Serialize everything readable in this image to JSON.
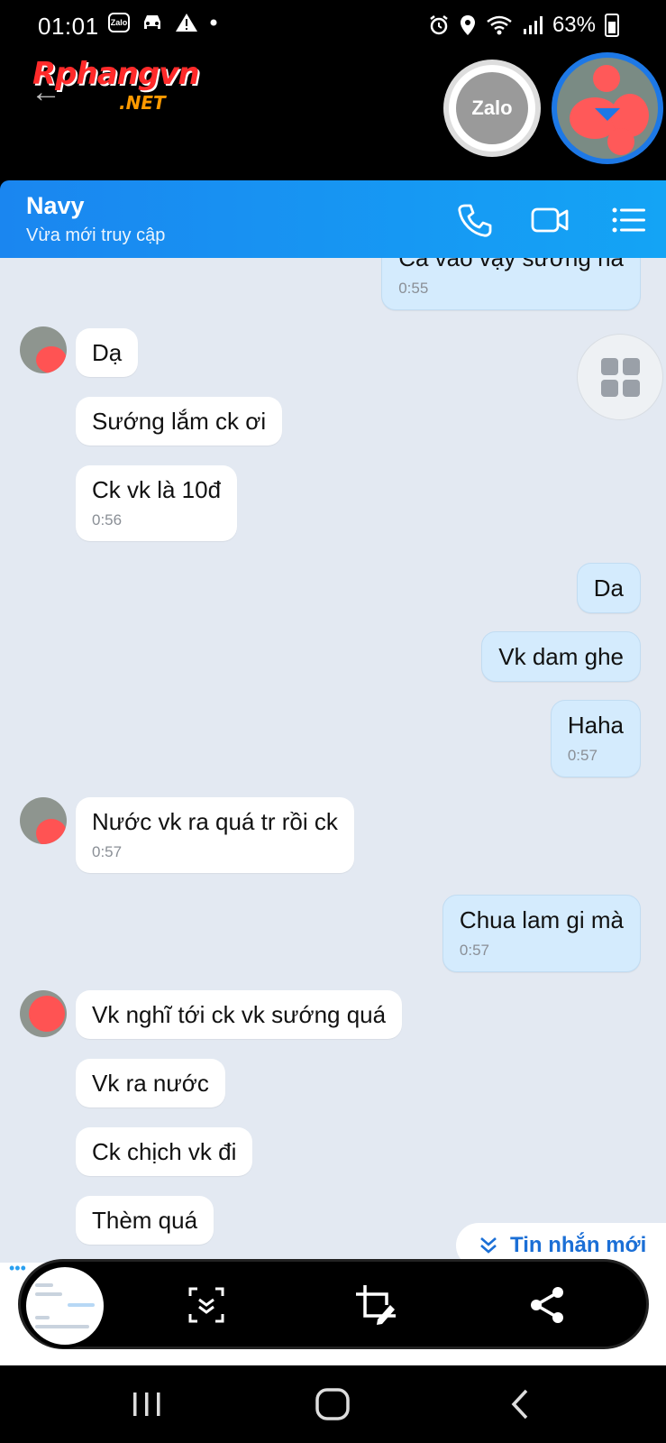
{
  "status_bar": {
    "time": "01:01",
    "zalo_icon_text": "Zalo",
    "battery": "63%"
  },
  "watermark": {
    "main": "Rphangvn",
    "sub": ".NET"
  },
  "zalo_bubble_label": "Zalo",
  "header": {
    "name": "Navy",
    "presence": "Vừa mới truy cập"
  },
  "messages": [
    {
      "id": "m0",
      "dir": "out",
      "text": "Ca vào vậy sướng ha",
      "time": "0:55"
    },
    {
      "id": "m1",
      "dir": "in",
      "text": "Dạ",
      "time": ""
    },
    {
      "id": "m2",
      "dir": "in",
      "text": "Sướng lắm ck ơi",
      "time": ""
    },
    {
      "id": "m3",
      "dir": "in",
      "text": "Ck vk là 10đ",
      "time": "0:56"
    },
    {
      "id": "m4",
      "dir": "out",
      "text": "Da",
      "time": ""
    },
    {
      "id": "m5",
      "dir": "out",
      "text": "Vk dam ghe",
      "time": ""
    },
    {
      "id": "m6",
      "dir": "out",
      "text": "Haha",
      "time": "0:57"
    },
    {
      "id": "m7",
      "dir": "in",
      "text": "Nước vk ra quá tr rồi ck",
      "time": "0:57"
    },
    {
      "id": "m8",
      "dir": "out",
      "text": "Chua lam gi mà",
      "time": "0:57"
    },
    {
      "id": "m9",
      "dir": "in",
      "text": "Vk nghĩ tới ck vk sướng quá",
      "time": ""
    },
    {
      "id": "m10",
      "dir": "in",
      "text": "Vk ra nước",
      "time": ""
    },
    {
      "id": "m11",
      "dir": "in",
      "text": "Ck chịch vk đi",
      "time": ""
    },
    {
      "id": "m12",
      "dir": "in",
      "text": "Thèm quá",
      "time": ""
    }
  ],
  "new_messages_label": "Tin nhắn mới",
  "colors": {
    "header_start": "#1a86f0",
    "header_end": "#14a4f5",
    "chat_bg": "#e3e9f2",
    "outgoing_bubble": "#d4ebfd",
    "incoming_bubble": "#ffffff",
    "link_blue": "#1b6fd6"
  },
  "icons": {
    "call": "phone-icon",
    "video": "video-camera-icon",
    "menu": "list-menu-icon",
    "scroll_capture": "scroll-capture-icon",
    "crop": "crop-edit-icon",
    "share": "share-icon",
    "recents": "recents-icon",
    "home": "home-icon",
    "back": "back-icon"
  }
}
